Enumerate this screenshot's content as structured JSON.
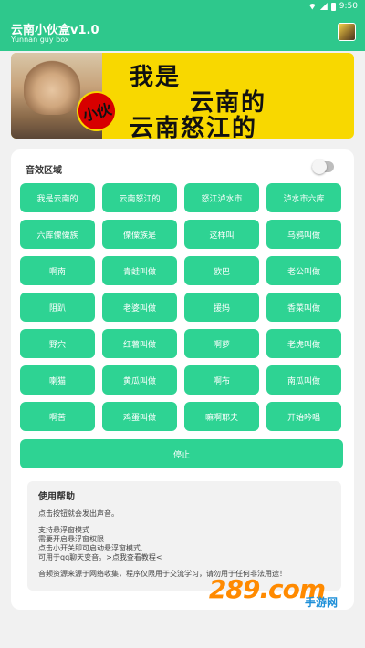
{
  "status_bar": {
    "time": "9:50"
  },
  "app_bar": {
    "title": "云南小伙盒v1.0",
    "subtitle": "Yunnan guy box"
  },
  "banner": {
    "tag": "小伙",
    "line1": "我是",
    "line2": "云南的",
    "line3": "云南怒江的"
  },
  "sound_section": {
    "title": "音效区域",
    "toggle_on": false
  },
  "sound_buttons": [
    "我是云南的",
    "云南怒江的",
    "怒江泸水市",
    "泸水市六库",
    "六库傈僳族",
    "傈僳族是",
    "这样叫",
    "乌鸦叫做",
    "啊南",
    "青蛙叫做",
    "欧巴",
    "老公叫做",
    "阻趴",
    "老婆叫做",
    "援妈",
    "香菜叫做",
    "野穴",
    "红薯叫做",
    "啊萝",
    "老虎叫做",
    "喇猫",
    "黄瓜叫做",
    "啊布",
    "南瓜叫做",
    "啊苦",
    "鸡蛋叫做",
    "嘛啊耶夫",
    "开始吟唱"
  ],
  "stop_button": "停止",
  "help": {
    "title": "使用帮助",
    "line1": "点击按钮就会发出声音。",
    "line2": "支持悬浮窗模式",
    "line3": "需要开启悬浮窗权限",
    "line4": "点击小开关即可启动悬浮窗模式,",
    "line5": "可用于qq聊天变音。>点我查看教程<",
    "line6": "音频资源来源于网络收集，程序仅限用于交流学习，请勿用于任何非法用途！"
  },
  "watermark": {
    "logo": "289.com",
    "text": "手游网"
  },
  "colors": {
    "primary": "#2ec88c",
    "button": "#2ed393",
    "banner_yellow": "#f8d800"
  }
}
